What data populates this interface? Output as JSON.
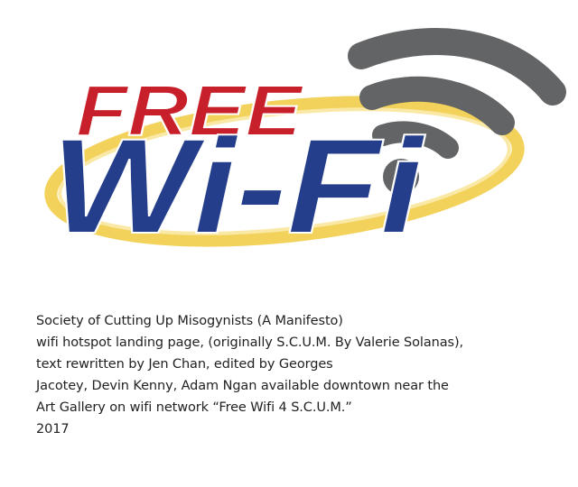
{
  "logo": {
    "word_top": "FREE",
    "word_bottom": "Wi-Fi",
    "colors": {
      "red": "#C8202A",
      "navy": "#243E8C",
      "yellow": "#F2D25A",
      "gray": "#636466"
    },
    "icon": "wifi-signal-icon"
  },
  "caption": {
    "lines": [
      "Society of Cutting Up Misogynists (A Manifesto)",
      "wifi hotspot landing page, (originally S.C.U.M. By Valerie Solanas),",
      "text rewritten by Jen Chan, edited by Georges",
      "Jacotey, Devin Kenny, Adam Ngan available downtown near the",
      "Art Gallery on wifi network “Free Wifi 4 S.C.U.M.”",
      "2017"
    ]
  }
}
